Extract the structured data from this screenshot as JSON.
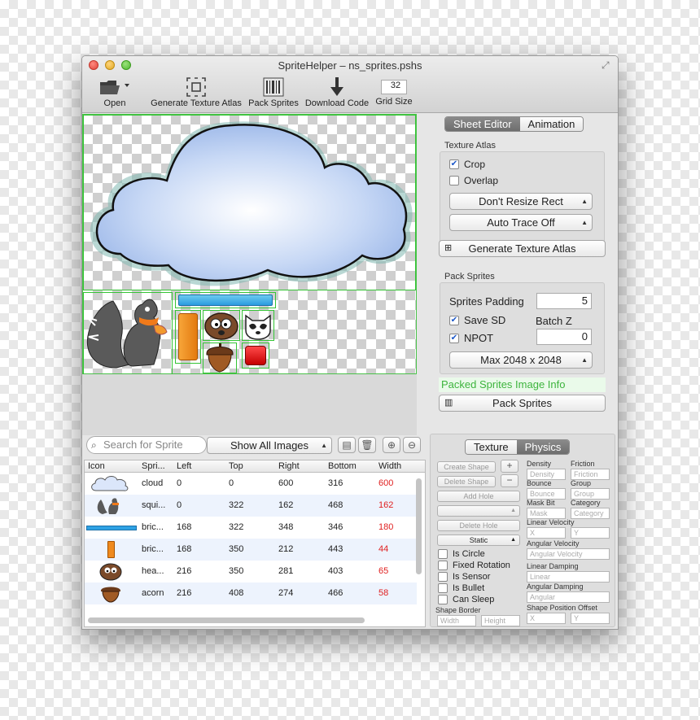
{
  "window": {
    "title": "SpriteHelper – ns_sprites.pshs"
  },
  "toolbar": {
    "open_label": "Open",
    "generate_label": "Generate Texture Atlas",
    "pack_label": "Pack Sprites",
    "download_label": "Download Code",
    "grid_size_label": "Grid Size",
    "grid_size_value": "32"
  },
  "right_panel": {
    "tabs": [
      "Sheet Editor",
      "Animation"
    ],
    "texture_atlas": {
      "title": "Texture Atlas",
      "crop_label": "Crop",
      "crop_checked": true,
      "overlap_label": "Overlap",
      "overlap_checked": false,
      "resize_popup": "Don't Resize Rect",
      "trace_popup": "Auto Trace Off",
      "generate_button": "Generate Texture Atlas"
    },
    "pack_sprites": {
      "title": "Pack Sprites",
      "padding_label": "Sprites Padding",
      "padding_value": "5",
      "save_sd_label": "Save SD",
      "save_sd_checked": true,
      "batch_z_label": "Batch Z",
      "batch_z_value": "0",
      "npot_label": "NPOT",
      "npot_checked": true,
      "max_popup": "Max 2048 x 2048",
      "info_text": "Packed Sprites Image Info",
      "pack_button": "Pack Sprites"
    }
  },
  "sprite_list": {
    "search_placeholder": "Search for Sprite",
    "filter_popup": "Show All Images",
    "columns": [
      "Icon",
      "Spri...",
      "Left",
      "Top",
      "Right",
      "Bottom",
      "Width"
    ],
    "rows": [
      {
        "name": "cloud",
        "left": "0",
        "top": "0",
        "right": "600",
        "bottom": "316",
        "width": "600",
        "icon": "cloud-icon"
      },
      {
        "name": "squi...",
        "left": "0",
        "top": "322",
        "right": "162",
        "bottom": "468",
        "width": "162",
        "icon": "squirrel-icon"
      },
      {
        "name": "bric...",
        "left": "168",
        "top": "322",
        "right": "348",
        "bottom": "346",
        "width": "180",
        "icon": "blue-brick-icon"
      },
      {
        "name": "bric...",
        "left": "168",
        "top": "350",
        "right": "212",
        "bottom": "443",
        "width": "44",
        "icon": "orange-brick-icon"
      },
      {
        "name": "hea...",
        "left": "216",
        "top": "350",
        "right": "281",
        "bottom": "403",
        "width": "65",
        "icon": "head-icon"
      },
      {
        "name": "acorn",
        "left": "216",
        "top": "408",
        "right": "274",
        "bottom": "466",
        "width": "58",
        "icon": "acorn-icon"
      }
    ]
  },
  "physics_panel": {
    "tabs": [
      "Texture",
      "Physics"
    ],
    "create_shape": "Create Shape",
    "delete_shape": "Delete Shape",
    "add_hole": "Add Hole",
    "delete_hole": "Delete Hole",
    "static_popup": "Static",
    "plus": "+",
    "minus": "−",
    "checks": [
      "Is Circle",
      "Fixed Rotation",
      "Is Sensor",
      "Is Bullet",
      "Can Sleep"
    ],
    "shape_border_label": "Shape Border",
    "width_ph": "Width",
    "height_ph": "Height",
    "density_label": "Density",
    "density_ph": "Density",
    "friction_label": "Friction",
    "friction_ph": "Friction",
    "bounce_label": "Bounce",
    "bounce_ph": "Bounce",
    "group_label": "Group",
    "group_ph": "Group",
    "maskbit_label": "Mask Bit",
    "mask_ph": "Mask",
    "category_label": "Category",
    "category_ph": "Category",
    "lin_vel_label": "Linear Velocity",
    "x_ph": "X",
    "y_ph": "Y",
    "ang_vel_label": "Angular Velocity",
    "ang_vel_ph": "Angular Velocity",
    "lin_damp_label": "Linear Damping",
    "linear_ph": "Linear",
    "ang_damp_label": "Angular Damping",
    "angular_ph": "Angular",
    "pos_offset_label": "Shape Position Offset"
  }
}
